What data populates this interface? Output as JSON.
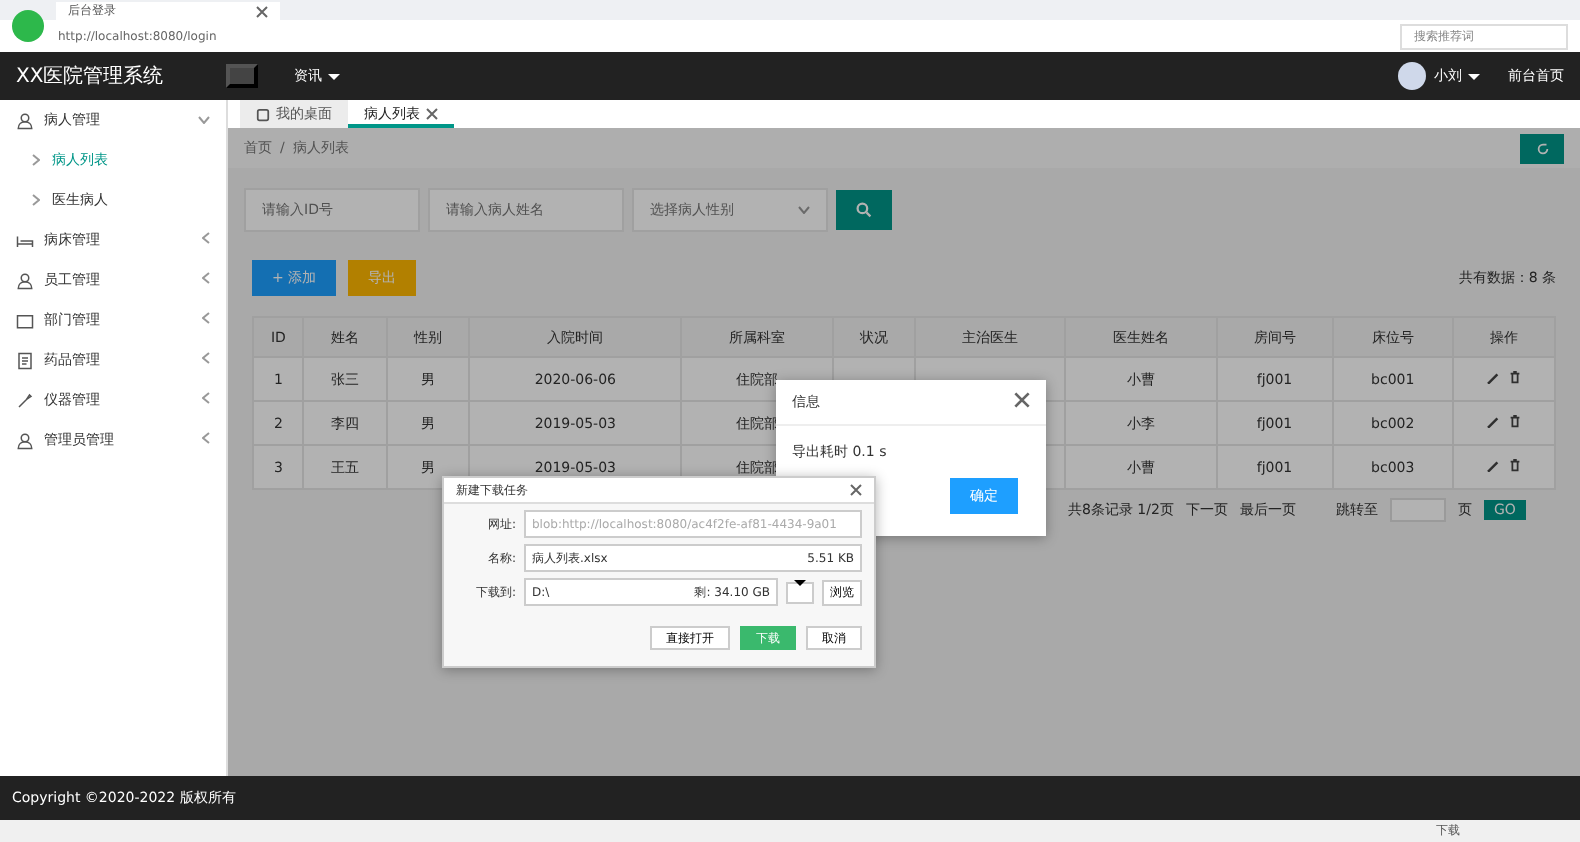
{
  "browser": {
    "tab_title": "后台登录",
    "url": "http://localhost:8080/login",
    "search_placeholder": "搜索推荐词"
  },
  "header": {
    "title": "XX医院管理系统",
    "menu": "资讯",
    "user": "小刘",
    "front_link": "前台首页"
  },
  "sidebar": {
    "items": [
      {
        "label": "病人管理",
        "expanded": true,
        "children": [
          {
            "label": "病人列表",
            "selected": true
          },
          {
            "label": "医生病人",
            "selected": false
          }
        ]
      },
      {
        "label": "病床管理",
        "expanded": false
      },
      {
        "label": "员工管理",
        "expanded": false
      },
      {
        "label": "部门管理",
        "expanded": false
      },
      {
        "label": "药品管理",
        "expanded": false
      },
      {
        "label": "仪器管理",
        "expanded": false
      },
      {
        "label": "管理员管理",
        "expanded": false
      }
    ]
  },
  "tabs": [
    {
      "label": "我的桌面",
      "selected": false,
      "closable": false
    },
    {
      "label": "病人列表",
      "selected": true,
      "closable": true
    }
  ],
  "breadcrumb": {
    "items": [
      "首页",
      "病人列表"
    ],
    "separator": "/"
  },
  "filters": {
    "id_placeholder": "请输入ID号",
    "name_placeholder": "请输入病人姓名",
    "gender_placeholder": "选择病人性别"
  },
  "actions": {
    "add": "+ 添加",
    "export": "导出",
    "total": "共有数据：8 条"
  },
  "table": {
    "columns": [
      "ID",
      "姓名",
      "性别",
      "入院时间",
      "所属科室",
      "状况",
      "主治医生",
      "医生姓名",
      "房间号",
      "床位号",
      "操作"
    ],
    "rows": [
      {
        "cells": [
          "1",
          "张三",
          "男",
          "2020-06-06",
          "住院部",
          null,
          null,
          "小曹",
          "fj001",
          "bc001"
        ]
      },
      {
        "cells": [
          "2",
          "李四",
          "男",
          "2019-05-03",
          "住院部",
          null,
          null,
          "小李",
          "fj001",
          "bc002"
        ]
      },
      {
        "cells": [
          "3",
          "王五",
          "男",
          "2019-05-03",
          "住院部",
          null,
          null,
          "小曹",
          "fj001",
          "bc003"
        ]
      }
    ]
  },
  "pagination": {
    "summary": "共8条记录 1/2页",
    "next": "下一页",
    "last": "最后一页",
    "jump_label": "跳转至",
    "page_unit": "页",
    "go": "GO"
  },
  "info_dialog": {
    "title": "信息",
    "message": "导出耗时 0.1 s",
    "ok": "确定"
  },
  "download_dialog": {
    "title": "新建下载任务",
    "url_label": "网址:",
    "url": "blob:http://localhost:8080/ac4f2fe-af81-4434-9a01",
    "name_label": "名称:",
    "name": "病人列表.xlsx",
    "size": "5.51 KB",
    "path_label": "下载到:",
    "path": "D:\\",
    "free": "剩: 34.10 GB",
    "browse": "浏览",
    "open": "直接打开",
    "download": "下载",
    "cancel": "取消"
  },
  "footer": {
    "copyright": "Copyright ©2020-2022 版权所有"
  },
  "status_bar": {
    "download": "下载"
  }
}
